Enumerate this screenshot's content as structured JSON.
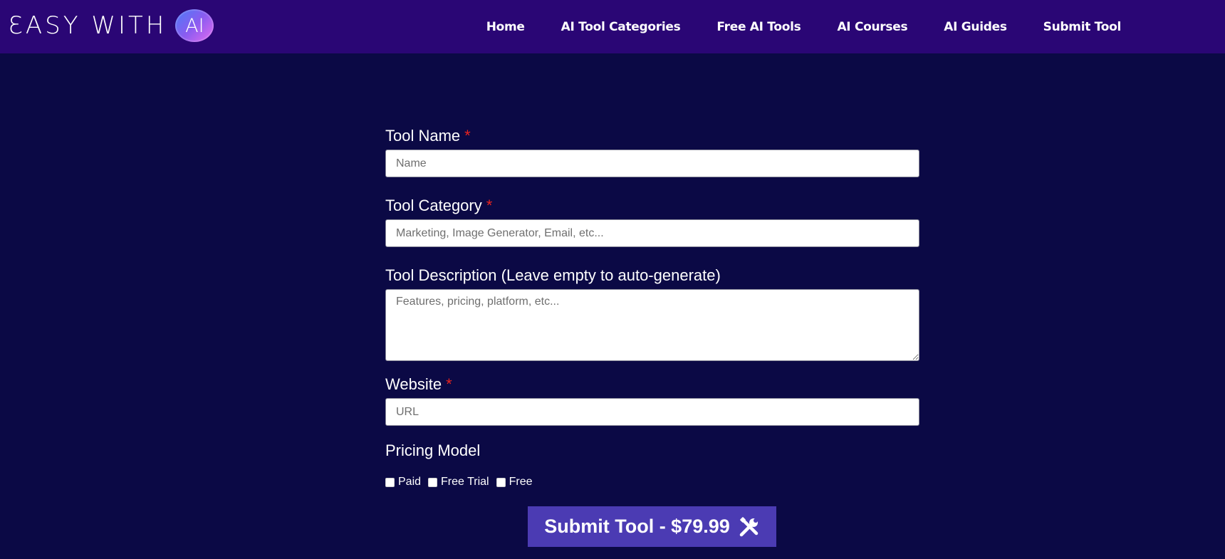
{
  "header": {
    "logo_text": "ƐASY WITH",
    "logo_badge": "AI",
    "nav": [
      "Home",
      "AI Tool Categories",
      "Free AI Tools",
      "AI Courses",
      "AI Guides",
      "Submit Tool"
    ]
  },
  "form": {
    "tool_name": {
      "label": "Tool Name",
      "required_mark": "*",
      "placeholder": "Name",
      "value": ""
    },
    "tool_category": {
      "label": "Tool Category",
      "required_mark": "*",
      "placeholder": "Marketing, Image Generator, Email, etc...",
      "value": ""
    },
    "tool_description": {
      "label": "Tool Description (Leave empty to auto-generate)",
      "placeholder": "Features, pricing, platform, etc...",
      "value": ""
    },
    "website": {
      "label": "Website",
      "required_mark": "*",
      "placeholder": "URL",
      "value": ""
    },
    "pricing_model": {
      "label": "Pricing Model",
      "options": [
        {
          "label": "Paid",
          "checked": false
        },
        {
          "label": "Free Trial",
          "checked": false
        },
        {
          "label": "Free",
          "checked": false
        }
      ]
    },
    "submit_label": "Submit Tool - $79.99",
    "submit_icon": "tools-icon"
  },
  "colors": {
    "page_bg": "#0b0945",
    "header_bg": "#2a0675",
    "button_bg": "#4b3bb3",
    "required": "#e8231f"
  }
}
